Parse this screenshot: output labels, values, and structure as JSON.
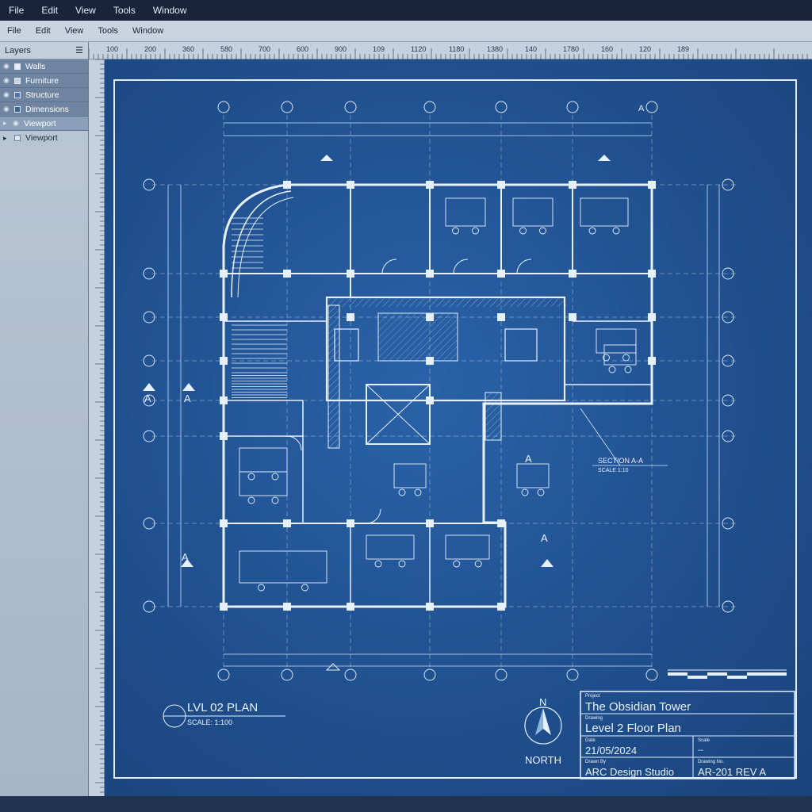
{
  "menu_top": [
    "File",
    "Edit",
    "View",
    "Tools",
    "Window"
  ],
  "menu_secondary": [
    "File",
    "Edit",
    "View",
    "Tools",
    "Window"
  ],
  "layers_panel": {
    "title": "Layers",
    "items": [
      {
        "label": "Walls",
        "state": "visible"
      },
      {
        "label": "Furniture",
        "state": "visible"
      },
      {
        "label": "Structure",
        "state": "visible"
      },
      {
        "label": "Dimensions",
        "state": "visible"
      },
      {
        "label": "Viewport",
        "state": "selected"
      },
      {
        "label": "Viewport",
        "state": "collapsed"
      }
    ]
  },
  "ruler_labels": [
    "100",
    "200",
    "360",
    "580",
    "700",
    "600",
    "900",
    "109",
    "1120",
    "1180",
    "1380",
    "140",
    "1780",
    "160",
    "120",
    "189"
  ],
  "drawing": {
    "plan_title": "LVL 02 PLAN",
    "plan_scale": "SCALE: 1:100",
    "section_label": "SECTION A-A",
    "section_scale": "SCALE 1:10",
    "section_marker": "A",
    "north_letter": "N",
    "north_label": "NORTH",
    "grid_letters": [
      "A",
      "A",
      "A",
      "A",
      "A",
      "A"
    ]
  },
  "title_block": {
    "project_caption": "Project",
    "project": "The Obsidian Tower",
    "drawing_caption": "Drawing",
    "drawing": "Level 2 Floor Plan",
    "date_caption": "Date",
    "date": "21/05/2024",
    "scale_caption": "Scale",
    "scale": "--",
    "drawn_caption": "Drawn By",
    "drawn_by": "ARC Design Studio",
    "number_caption": "Drawing No.",
    "drawing_number": "AR-201 REV A"
  },
  "colors": {
    "blueprint_bg": "#20508f",
    "line": "#dbe8f8",
    "toolbar_dark": "#17243a",
    "panel": "#b9c7d6"
  }
}
